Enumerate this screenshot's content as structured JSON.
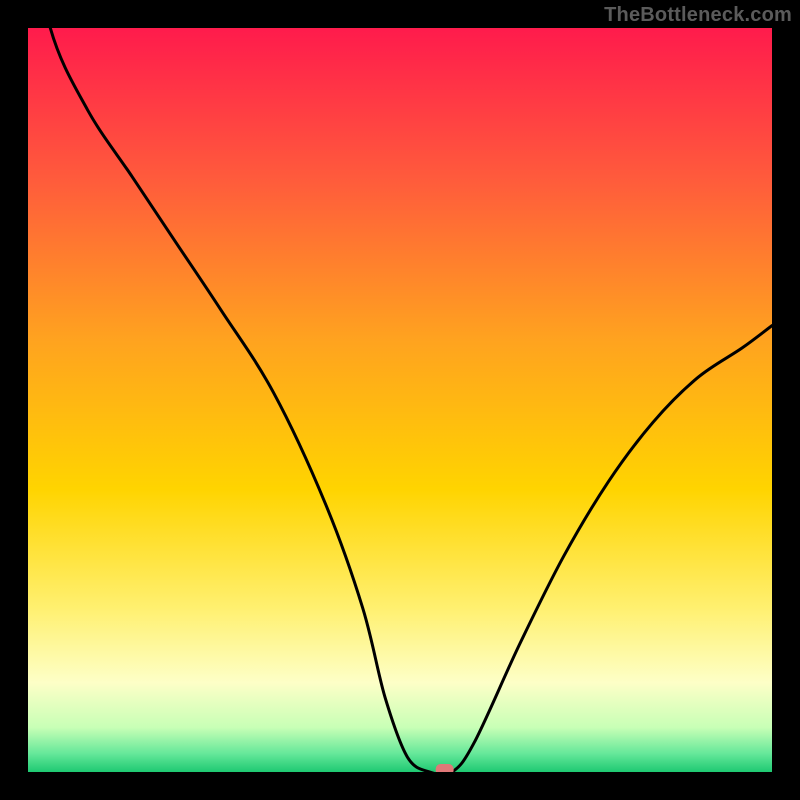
{
  "attribution": "TheBottleneck.com",
  "chart_data": {
    "type": "line",
    "title": "",
    "xlabel": "",
    "ylabel": "",
    "xlim": [
      0,
      100
    ],
    "ylim": [
      0,
      100
    ],
    "grid": false,
    "legend": false,
    "x": [
      0,
      3,
      8,
      14,
      20,
      26,
      33,
      40,
      45,
      48,
      51,
      54,
      57,
      60,
      66,
      72,
      78,
      84,
      90,
      96,
      100
    ],
    "values": [
      117,
      100,
      89,
      80,
      71,
      62,
      51,
      36,
      22,
      10,
      2,
      0,
      0,
      4,
      17,
      29,
      39,
      47,
      53,
      57,
      60
    ],
    "notes": "V-shaped bottleneck curve over a vertical red→yellow→green gradient background; optimum (flat zero) occurs roughly at x≈54–57% with a small pink marker near the minimum."
  },
  "marker": {
    "x_pct": 56,
    "y_pct": 0,
    "color": "#e07878"
  },
  "gradient": {
    "stops": [
      {
        "offset": 0,
        "color": "#ff1b4c"
      },
      {
        "offset": 0.2,
        "color": "#ff5a3c"
      },
      {
        "offset": 0.42,
        "color": "#ffa31f"
      },
      {
        "offset": 0.62,
        "color": "#ffd400"
      },
      {
        "offset": 0.78,
        "color": "#fff070"
      },
      {
        "offset": 0.88,
        "color": "#fdffc7"
      },
      {
        "offset": 0.94,
        "color": "#c8ffb6"
      },
      {
        "offset": 0.975,
        "color": "#66e89a"
      },
      {
        "offset": 1.0,
        "color": "#1ec972"
      }
    ]
  }
}
